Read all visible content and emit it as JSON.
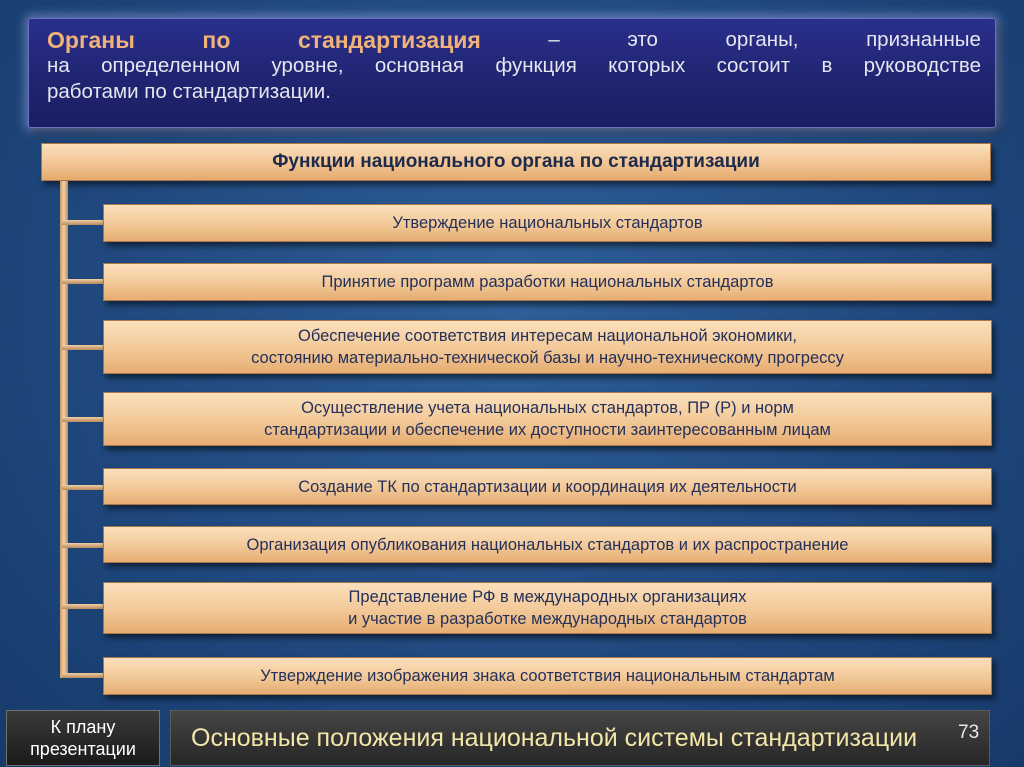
{
  "definition": {
    "term": "Органы по стандартизация",
    "lines": [
      [
        "–",
        "это",
        "органы,",
        "признанные"
      ],
      [
        "на",
        "определенном",
        "уровне,",
        "основная",
        "функция",
        "которых",
        "состоит",
        "в",
        "руководстве"
      ],
      "работами по стандартизации."
    ]
  },
  "heading": "Функции национального органа по стандартизации",
  "functions": [
    "Утверждение национальных стандартов",
    "Принятие программ разработки национальных стандартов",
    "Обеспечение соответствия интересам национальной экономики,\nсостоянию материально-технической базы и научно-техническому прогрессу",
    "Осуществление учета национальных стандартов, ПР (Р) и норм\nстандартизации и обеспечение их доступности заинтересованным лицам",
    "Создание ТК по стандартизации и координация их деятельности",
    "Организация опубликования национальных стандартов и их распространение",
    "Представление РФ в международных организациях\nи участие в  разработке международных стандартов",
    "Утверждение изображения знака соответствия национальным стандартам"
  ],
  "footer": {
    "nav_line1": "К плану",
    "nav_line2": "презентации",
    "title": "Основные положения национальной системы стандартизации",
    "page": "73"
  },
  "colors": {
    "background": "#234d84",
    "definition_box": "#1f2470",
    "term": "#f0b27a",
    "box_fill": "#f2c897",
    "box_text": "#24305a",
    "footer_text": "#f3e6a8"
  }
}
